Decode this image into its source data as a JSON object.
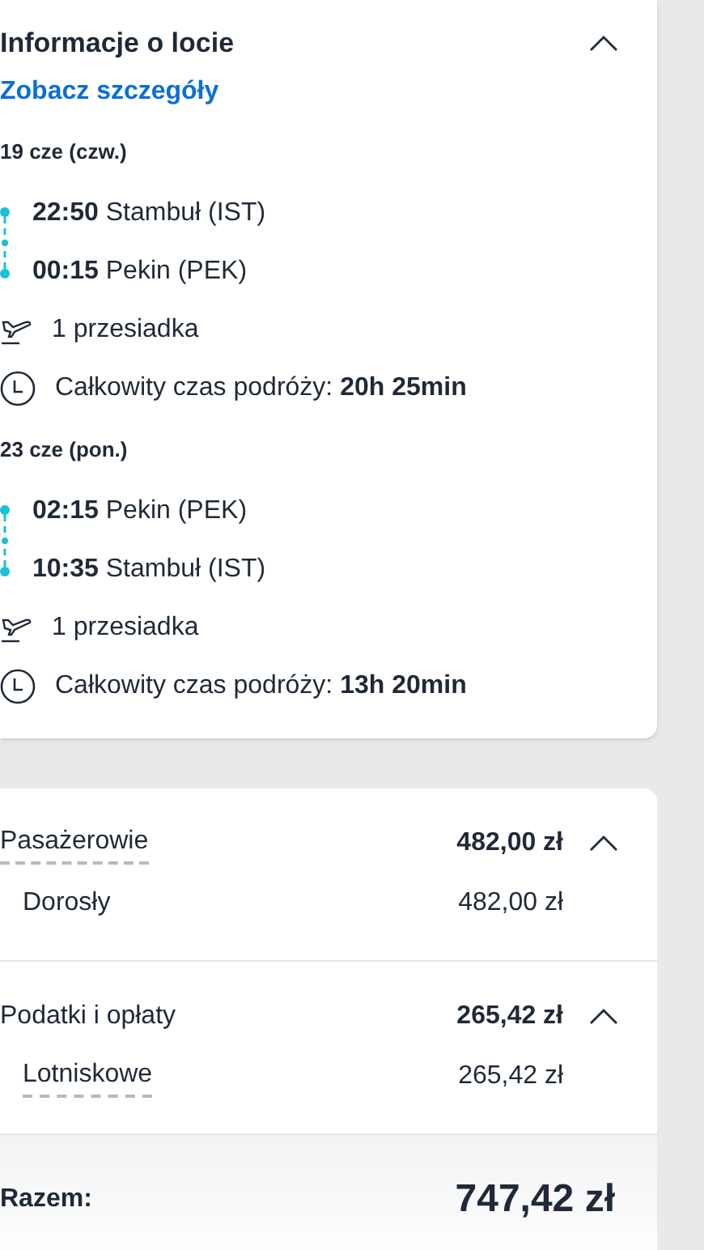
{
  "flight_info": {
    "title": "Informacje o locie",
    "expanded": true,
    "details_link": "Zobacz szczegóły",
    "segments": [
      {
        "date": "19 cze (czw.)",
        "stops": [
          {
            "time": "22:50",
            "place": "Stambuł (IST)"
          },
          {
            "time": "00:15",
            "place": "Pekin (PEK)"
          }
        ],
        "transfers": "1 przesiadka",
        "total_label": "Całkowity czas podróży:",
        "total_value": "20h 25min"
      },
      {
        "date": "23 cze (pon.)",
        "stops": [
          {
            "time": "02:15",
            "place": "Pekin (PEK)"
          },
          {
            "time": "10:35",
            "place": "Stambuł (IST)"
          }
        ],
        "transfers": "1 przesiadka",
        "total_label": "Całkowity czas podróży:",
        "total_value": "13h 20min"
      }
    ]
  },
  "price": {
    "groups": [
      {
        "label": "Pasażerowie",
        "underlined": true,
        "amount": "482,00 zł",
        "expanded": true,
        "items": [
          {
            "label": "Dorosły",
            "underlined": false,
            "amount": "482,00 zł"
          }
        ]
      },
      {
        "label": "Podatki i opłaty",
        "underlined": false,
        "amount": "265,42 zł",
        "expanded": true,
        "items": [
          {
            "label": "Lotniskowe",
            "underlined": true,
            "amount": "265,42 zł"
          }
        ]
      }
    ],
    "total": {
      "label": "Razem:",
      "amount": "747,42 zł"
    }
  }
}
